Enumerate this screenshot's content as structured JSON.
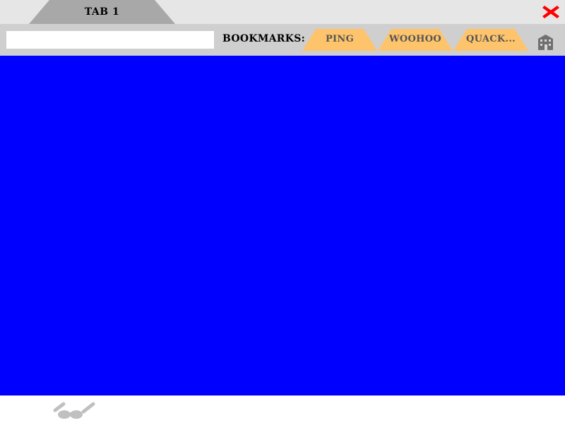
{
  "tabs": [
    {
      "label": "TAB 1"
    }
  ],
  "window": {
    "close_icon": "close-x-icon",
    "close_color": "#ff0000"
  },
  "toolbar": {
    "url_value": "",
    "bookmarks_label": "BOOKMARKS:",
    "bookmarks": [
      {
        "label": "PING"
      },
      {
        "label": "WOOHOO"
      },
      {
        "label": "QUACK..."
      }
    ],
    "home_icon": "home-building-icon"
  },
  "viewport": {
    "background_color": "#0000ff"
  },
  "bottom": {
    "glasses_icon": "glasses-icon"
  },
  "colors": {
    "tabbar_bg": "#e6e6e6",
    "active_tab": "#a8a8a8",
    "toolbar_bg": "#cfcfcf",
    "bookmark_bg": "#fec46c",
    "bookmark_text": "#555555"
  }
}
